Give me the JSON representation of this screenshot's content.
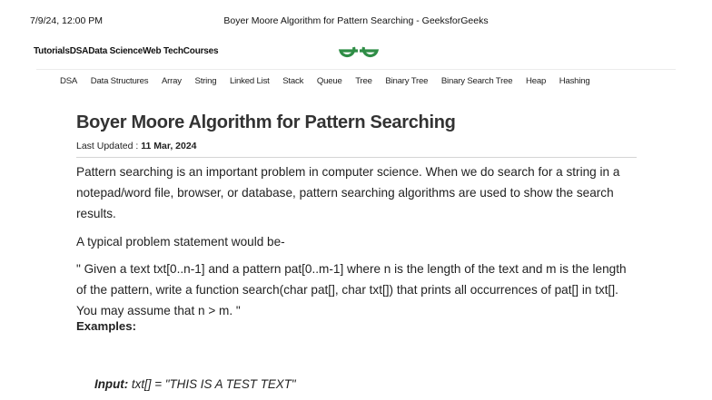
{
  "print_header": {
    "datetime": "7/9/24, 12:00 PM",
    "page_title": "Boyer Moore Algorithm for Pattern Searching - GeeksforGeeks"
  },
  "top_nav": [
    "Tutorials",
    "DSA",
    "Data Science",
    "Web Tech",
    "Courses"
  ],
  "logo": {
    "name": "gfg-logo",
    "color": "#2f8d46"
  },
  "category_nav": [
    "DSA",
    "Data Structures",
    "Array",
    "String",
    "Linked List",
    "Stack",
    "Queue",
    "Tree",
    "Binary Tree",
    "Binary Search Tree",
    "Heap",
    "Hashing"
  ],
  "article": {
    "title": "Boyer Moore Algorithm for Pattern Searching",
    "updated_label": "Last Updated : ",
    "updated_date": "11 Mar, 2024",
    "p1": "Pattern searching is an important problem in computer science. When we do search for a string in a notepad/word file, browser, or database, pattern searching algorithms are used to show the search results.",
    "p2": "A typical problem statement would be-",
    "p3": "\" Given a text txt[0..n-1] and a pattern pat[0..m-1] where n is the length of the text and m is the length of the pattern, write a function search(char pat[], char txt[]) that prints all occurrences of pat[] in txt[]. You may assume that n > m. \"",
    "examples_heading": "Examples:",
    "example_input_label": "Input:",
    "example_input_value": " txt[] = \"THIS IS A TEST TEXT\""
  }
}
